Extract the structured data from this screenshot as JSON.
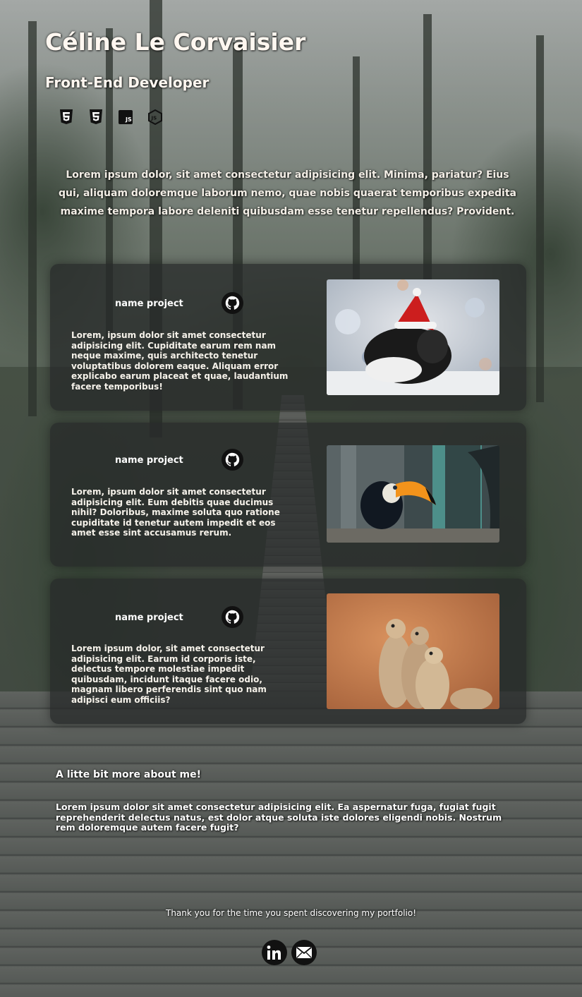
{
  "header": {
    "name": "Céline Le Corvaisier",
    "role": "Front-End Developer",
    "skills": [
      {
        "icon": "html5-icon"
      },
      {
        "icon": "css3-icon"
      },
      {
        "icon": "javascript-icon"
      },
      {
        "icon": "nodejs-icon"
      }
    ]
  },
  "intro": "Lorem ipsum dolor, sit amet consectetur adipisicing elit. Minima, pariatur? Eius qui, aliquam doloremque laborum nemo, quae nobis quaerat temporibus expedita maxime tempora labore deleniti quibusdam esse tenetur repellendus? Provident.",
  "projects": [
    {
      "title": "name project",
      "description": "Lorem, ipsum dolor sit amet consectetur adipisicing elit. Cupiditate earum rem nam neque maxime, quis architecto tenetur voluptatibus dolorem eaque. Aliquam error explicabo earum placeat et quae, laudantium facere temporibus!",
      "image": "guinea-pig-santa-hat-photo"
    },
    {
      "title": "name project",
      "description": "Lorem, ipsum dolor sit amet consectetur adipisicing elit. Eum debitis quae ducimus nihil? Doloribus, maxime soluta quo ratione cupiditate id tenetur autem impedit et eos amet esse sint accusamus rerum.",
      "image": "toucan-photo"
    },
    {
      "title": "name project",
      "description": "Lorem ipsum dolor, sit amet consectetur adipisicing elit. Earum id corporis iste, delectus tempore molestiae impedit quibusdam, incidunt itaque facere odio, magnam libero perferendis sint quo nam adipisci eum officiis?",
      "image": "meerkats-photo"
    }
  ],
  "about": {
    "title": "A litte bit more about me!",
    "text": "Lorem ipsum dolor sit amet consectetur adipisicing elit. Ea aspernatur fuga, fugiat fugit reprehenderit delectus natus, est dolor atque soluta iste dolores eligendi nobis. Nostrum rem doloremque autem facere fugit?"
  },
  "footer": {
    "thanks": "Thank you for the time you spent discovering my portfolio!",
    "socials": [
      {
        "icon": "linkedin-icon"
      },
      {
        "icon": "email-icon"
      }
    ]
  },
  "colors": {
    "card_bg": "#262828",
    "heading_text": "#fff7f0",
    "social_bg": "#111111"
  }
}
